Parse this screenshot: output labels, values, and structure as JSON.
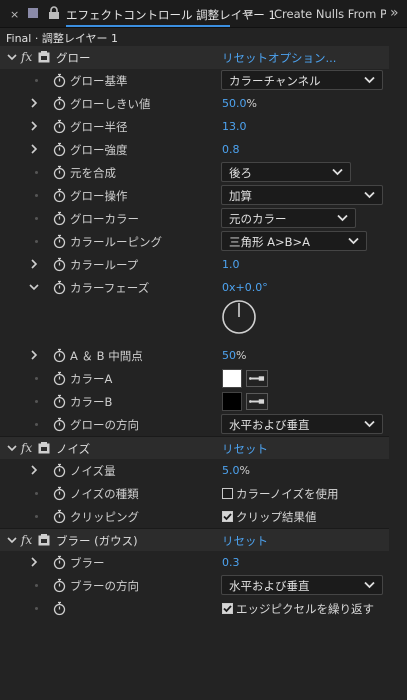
{
  "tabs": {
    "close": "×",
    "panel_title": "エフェクトコントロール 調整レイヤー 1",
    "menu": "≡",
    "second_tab": "Create Nulls From Path",
    "more": "»"
  },
  "breadcrumb": "Final · 調整レイヤー 1",
  "glow": {
    "name": "グロー",
    "reset": "リセット",
    "options": "オプション...",
    "glow_based_on": {
      "label": "グロー基準",
      "value": "カラーチャンネル"
    },
    "threshold": {
      "label": "グローしきい値",
      "value": "50.0",
      "unit": "%"
    },
    "radius": {
      "label": "グロー半径",
      "value": "13.0"
    },
    "intensity": {
      "label": "グロー強度",
      "value": "0.8"
    },
    "composite": {
      "label": "元を合成",
      "value": "後ろ"
    },
    "operation": {
      "label": "グロー操作",
      "value": "加算"
    },
    "colors": {
      "label": "グローカラー",
      "value": "元のカラー"
    },
    "color_looping": {
      "label": "カラールーピング",
      "value": "三角形 A>B>A"
    },
    "color_loops": {
      "label": "カラーループ",
      "value": "1.0"
    },
    "color_phase": {
      "label": "カラーフェーズ",
      "value": "0x+0.0°",
      "angle_deg": 0
    },
    "ab_midpoint": {
      "label": "A ＆ B 中間点",
      "value": "50",
      "unit": "%"
    },
    "color_a": {
      "label": "カラーA",
      "color": "#ffffff"
    },
    "color_b": {
      "label": "カラーB",
      "color": "#000000"
    },
    "dimensions": {
      "label": "グローの方向",
      "value": "水平および垂直"
    }
  },
  "noise": {
    "name": "ノイズ",
    "reset": "リセット",
    "amount": {
      "label": "ノイズ量",
      "value": "5.0",
      "unit": "%"
    },
    "type": {
      "label": "ノイズの種類",
      "checkbox": "カラーノイズを使用",
      "checked": false
    },
    "clipping": {
      "label": "クリッピング",
      "checkbox": "クリップ結果値",
      "checked": true
    }
  },
  "blur": {
    "name": "ブラー (ガウス)",
    "reset": "リセット",
    "blurriness": {
      "label": "ブラー",
      "value": "0.3"
    },
    "dimensions": {
      "label": "ブラーの方向",
      "value": "水平および垂直"
    },
    "repeat_edge": {
      "checkbox": "エッジピクセルを繰り返す",
      "checked": true
    }
  },
  "colors": {
    "accent": "#4da3f0",
    "background": "#232323",
    "header_row": "#2c2c2c"
  }
}
